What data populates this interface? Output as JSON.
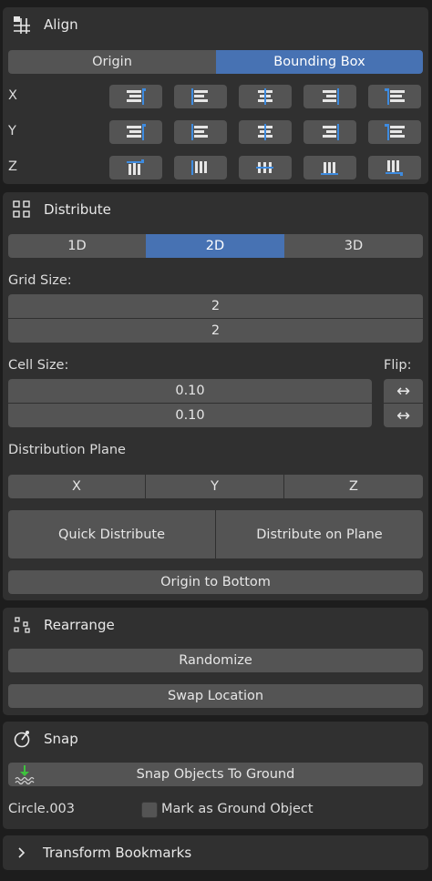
{
  "align": {
    "title": "Align",
    "icon": "align-grid-icon",
    "mode_tabs": [
      {
        "label": "Origin",
        "active": false
      },
      {
        "label": "Bounding Box",
        "active": true
      }
    ],
    "axes": [
      "X",
      "Y",
      "Z"
    ]
  },
  "distribute": {
    "title": "Distribute",
    "icon": "grid-squares-icon",
    "dimension_tabs": [
      {
        "label": "1D",
        "active": false
      },
      {
        "label": "2D",
        "active": true
      },
      {
        "label": "3D",
        "active": false
      }
    ],
    "grid_size_label": "Grid Size:",
    "grid_size_values": [
      "2",
      "2"
    ],
    "cell_size_label": "Cell Size:",
    "flip_label": "Flip:",
    "cell_size_values": [
      "0.10",
      "0.10"
    ],
    "flip_glyph": "↔",
    "distribution_plane_label": "Distribution Plane",
    "plane_axes": [
      "X",
      "Y",
      "Z"
    ],
    "quick_distribute": "Quick Distribute",
    "distribute_on_plane": "Distribute on Plane",
    "origin_to_bottom": "Origin to Bottom"
  },
  "rearrange": {
    "title": "Rearrange",
    "icon": "scatter-dots-icon",
    "randomize": "Randomize",
    "swap_location": "Swap Location"
  },
  "snap": {
    "title": "Snap",
    "icon": "snap-magnet-icon",
    "snap_to_ground": "Snap Objects To Ground",
    "object_name": "Circle.003",
    "mark_ground_label": "Mark as Ground Object",
    "mark_ground_checked": false
  },
  "bookmarks": {
    "title": "Transform Bookmarks",
    "expanded": false
  },
  "colors": {
    "background": "#1d1d1d",
    "panel": "#303030",
    "button": "#545454",
    "accent": "#4772b3",
    "icon_blue": "#3d8be0",
    "ground_green": "#3ec23e"
  }
}
